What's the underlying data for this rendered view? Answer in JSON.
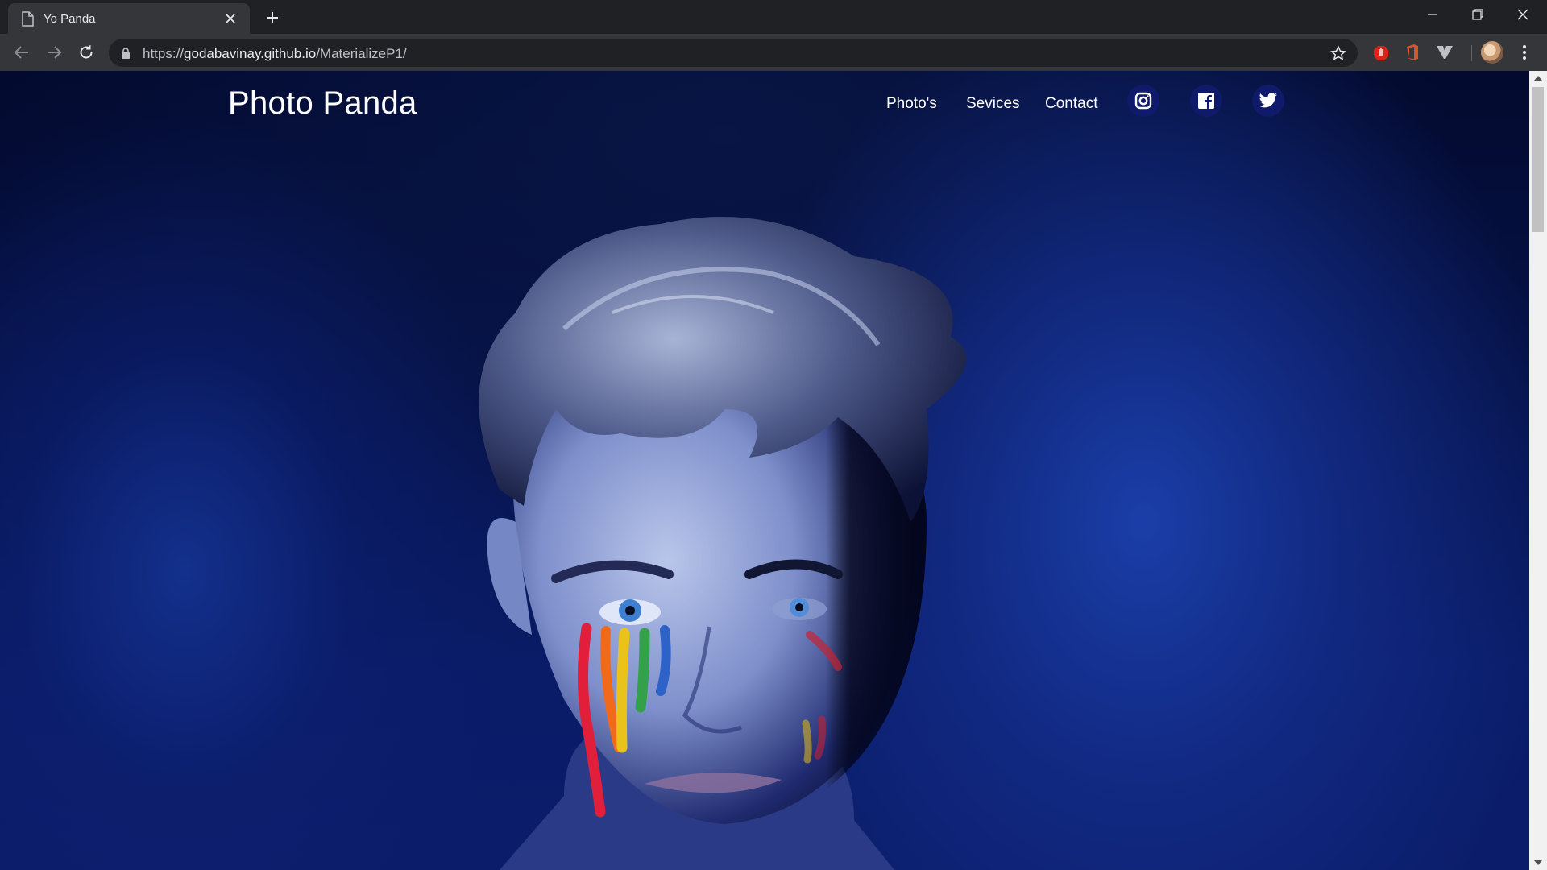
{
  "browser": {
    "tab_title": "Yo Panda",
    "url_prefix": "https://",
    "url_host": "godabavinay.github.io",
    "url_path": "/MaterializeP1/",
    "accent": "#35363a"
  },
  "site": {
    "brand": "Photo Panda",
    "nav": [
      "Photo's",
      "Sevices",
      "Contact"
    ],
    "social_icons": [
      "instagram-icon",
      "facebook-icon",
      "twitter-icon"
    ],
    "social_bg": "#101a6a"
  }
}
